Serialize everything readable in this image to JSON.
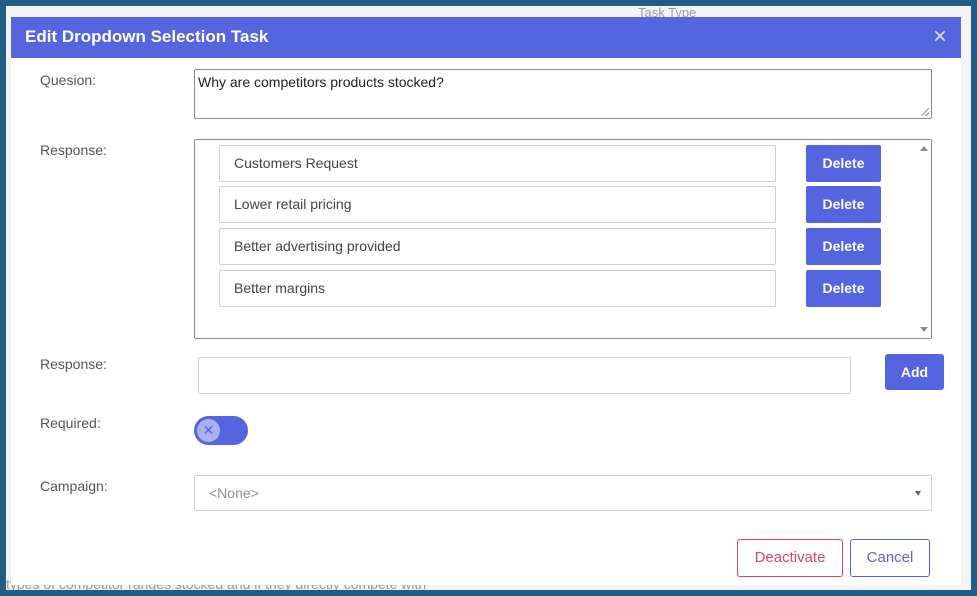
{
  "background": {
    "task_type_text": "Task Type",
    "footer_text": "types of competitor ranges stocked and if they directly compete with"
  },
  "modal": {
    "title": "Edit Dropdown Selection Task",
    "close_icon": "close-icon",
    "question": {
      "label": "Quesion:",
      "value": "Why are competitors products stocked?"
    },
    "responses": {
      "label": "Response:",
      "items": [
        {
          "value": "Customers Request",
          "delete_label": "Delete"
        },
        {
          "value": "Lower retail pricing",
          "delete_label": "Delete"
        },
        {
          "value": "Better advertising provided",
          "delete_label": "Delete"
        },
        {
          "value": "Better margins",
          "delete_label": "Delete"
        }
      ]
    },
    "new_response": {
      "label": "Response:",
      "value": "",
      "add_label": "Add"
    },
    "required": {
      "label": "Required:",
      "on": false
    },
    "campaign": {
      "label": "Campaign:",
      "selected": "<None>"
    },
    "footer": {
      "deactivate_label": "Deactivate",
      "cancel_label": "Cancel"
    }
  },
  "colors": {
    "accent": "#5565df",
    "danger": "#e0475d",
    "frame": "#1f5d86"
  }
}
